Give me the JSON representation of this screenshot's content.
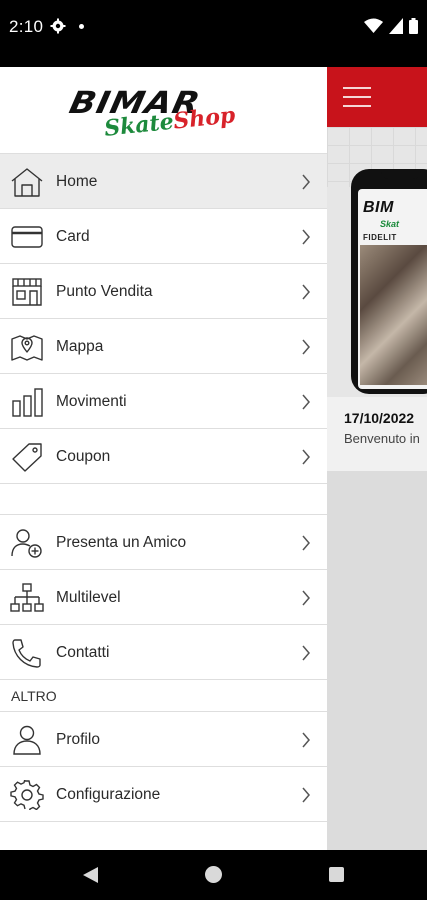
{
  "status_bar": {
    "time": "2:10"
  },
  "background_app": {
    "news_date": "17/10/2022",
    "news_text": "Benvenuto in",
    "phone_logo": "BIM",
    "phone_sub": "Skat",
    "phone_banner": "FIDELIT",
    "accent_color": "#c8131b"
  },
  "drawer": {
    "logo": {
      "brand": "BIMAR",
      "sub_green": "Skate",
      "sub_red": "Shop"
    },
    "items": [
      {
        "label": "Home",
        "icon": "home-icon"
      },
      {
        "label": "Card",
        "icon": "card-icon"
      },
      {
        "label": "Punto Vendita",
        "icon": "store-icon"
      },
      {
        "label": "Mappa",
        "icon": "map-icon"
      },
      {
        "label": "Movimenti",
        "icon": "bar-chart-icon"
      },
      {
        "label": "Coupon",
        "icon": "tag-icon"
      },
      {
        "label": "Presenta un Amico",
        "icon": "add-user-icon"
      },
      {
        "label": "Multilevel",
        "icon": "hierarchy-icon"
      },
      {
        "label": "Contatti",
        "icon": "phone-icon"
      }
    ],
    "section_other": "ALTRO",
    "other_items": [
      {
        "label": "Profilo",
        "icon": "user-icon"
      },
      {
        "label": "Configurazione",
        "icon": "gear-icon"
      }
    ]
  }
}
